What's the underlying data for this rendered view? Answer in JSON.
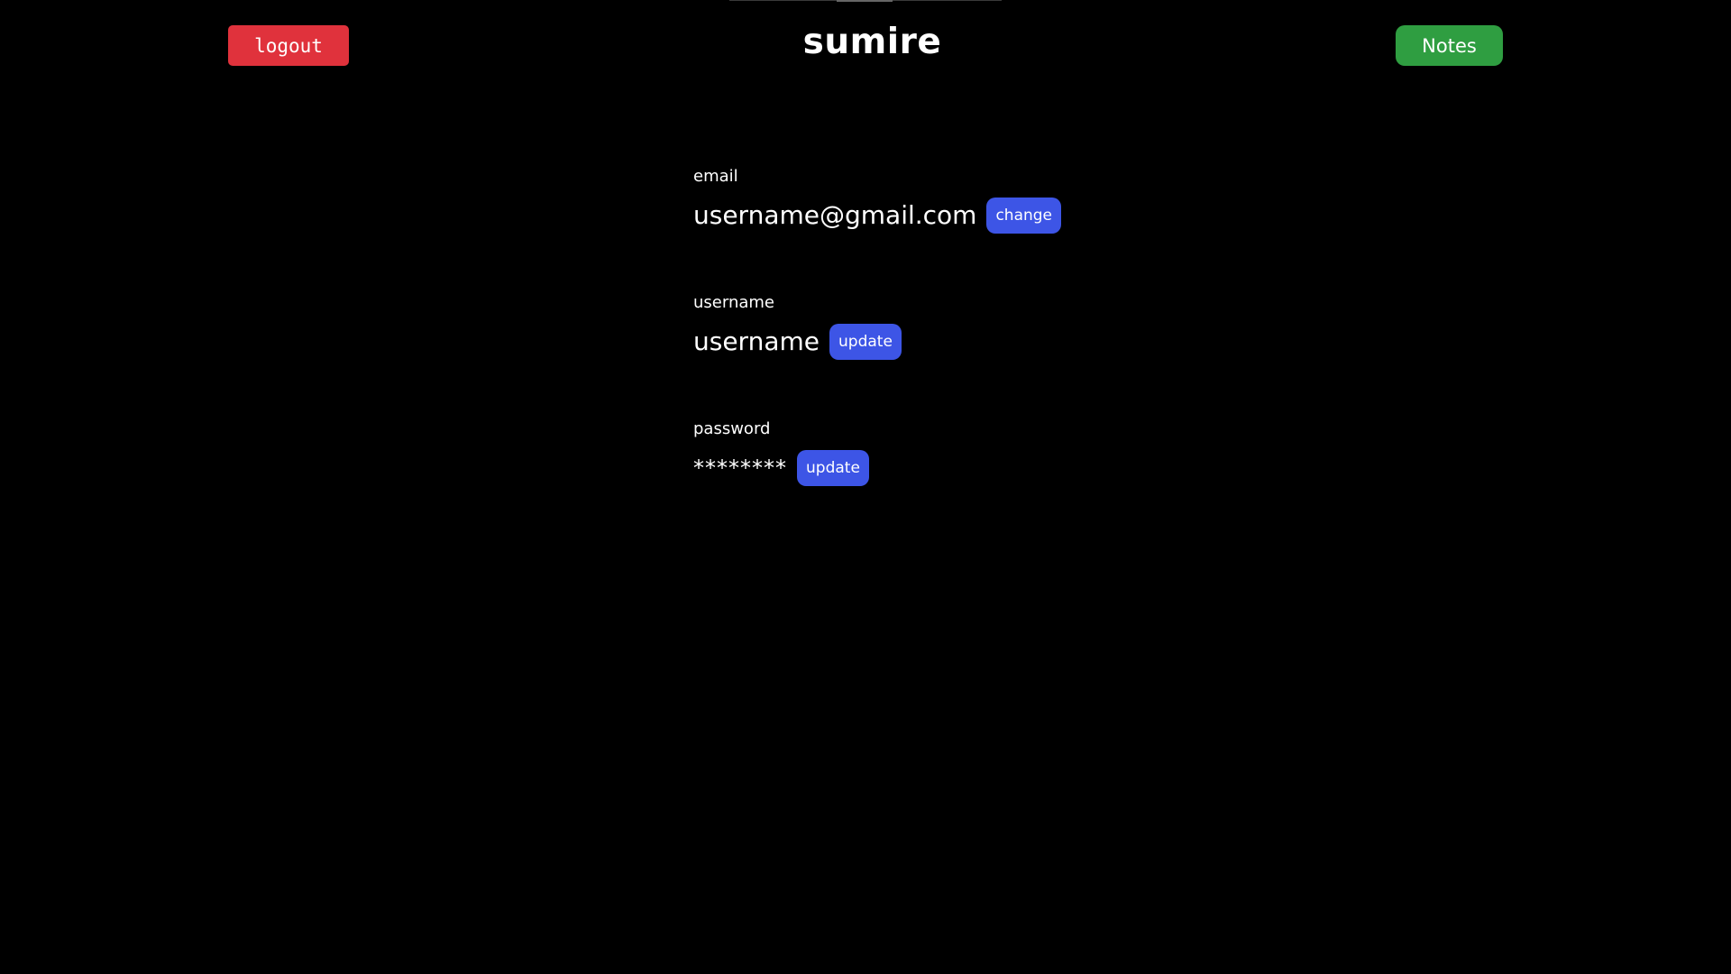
{
  "header": {
    "logout_label": "logout",
    "title": "sumire",
    "notes_label": "Notes"
  },
  "account": {
    "email": {
      "label": "email",
      "value": "username@gmail.com",
      "action_label": "change"
    },
    "username": {
      "label": "username",
      "value": "username",
      "action_label": "update"
    },
    "password": {
      "label": "password",
      "value": "********",
      "action_label": "update"
    }
  },
  "colors": {
    "background": "#000000",
    "logout": "#e0323c",
    "notes": "#2f9e41",
    "action": "#3d55e6",
    "text": "#ffffff"
  }
}
